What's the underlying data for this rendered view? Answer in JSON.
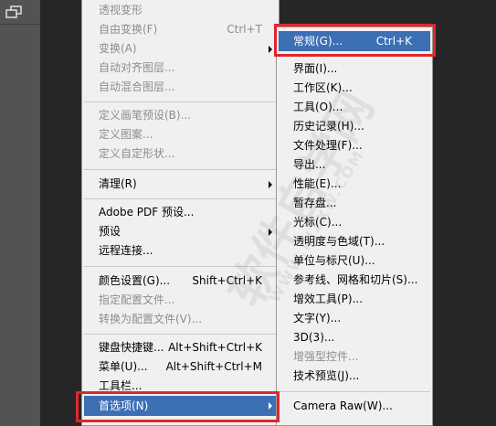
{
  "colors": {
    "highlight": "#3d6fb5",
    "annotation": "#e0272b",
    "menu_bg": "#f0f0f0",
    "disabled_text": "#8d8d8d"
  },
  "toolbar": {
    "arrange_icon": "arrange-windows-icon"
  },
  "main_menu": {
    "transform_perspective": "透视变形",
    "free_transform": {
      "label": "自由变换(F)",
      "shortcut": "Ctrl+T"
    },
    "transform": "变换(A)",
    "auto_align": "自动对齐图层...",
    "auto_blend": "自动混合图层...",
    "define_brush": "定义画笔预设(B)...",
    "define_pattern": "定义图案...",
    "define_shape": "定义自定形状...",
    "purge": "清理(R)",
    "adobe_pdf": "Adobe PDF 预设...",
    "presets": "预设",
    "remote_connections": "远程连接...",
    "color_settings": {
      "label": "颜色设置(G)...",
      "shortcut": "Shift+Ctrl+K"
    },
    "assign_profile": "指定配置文件...",
    "convert_profile": "转换为配置文件(V)...",
    "keyboard_shortcuts": {
      "label": "键盘快捷键...",
      "shortcut": "Alt+Shift+Ctrl+K"
    },
    "menus": {
      "label": "菜单(U)...",
      "shortcut": "Alt+Shift+Ctrl+M"
    },
    "toolbar_item": "工具栏...",
    "preferences": "首选项(N)"
  },
  "sub_menu": {
    "general": {
      "label": "常规(G)...",
      "shortcut": "Ctrl+K"
    },
    "interface": "界面(I)...",
    "workspace": "工作区(K)...",
    "tools": "工具(O)...",
    "history": "历史记录(H)...",
    "file_handling": "文件处理(F)...",
    "export": "导出...",
    "performance": "性能(E)...",
    "scratch_disks": "暂存盘...",
    "cursors": "光标(C)...",
    "transparency": "透明度与色域(T)...",
    "units": "单位与标尺(U)...",
    "guides": "参考线、网格和切片(S)...",
    "plugins": "增效工具(P)...",
    "type": "文字(Y)...",
    "three_d": "3D(3)...",
    "enhanced_controls": "增强型控件...",
    "tech_previews": "技术预览(J)...",
    "camera_raw": "Camera Raw(W)..."
  },
  "watermark": {
    "text": "软件自学网",
    "url": "WWW.RJZXW.COM"
  }
}
